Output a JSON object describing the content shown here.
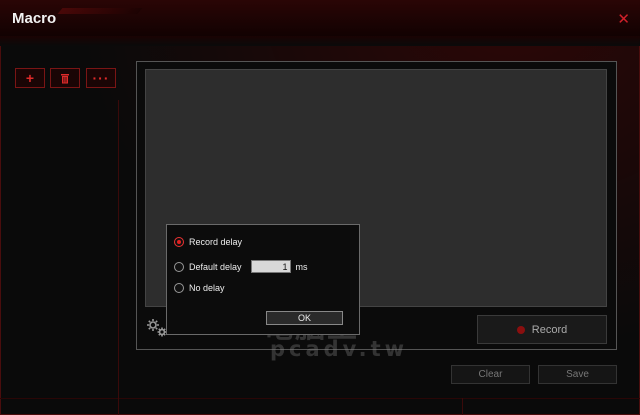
{
  "window": {
    "title": "Macro",
    "close_label": "✕"
  },
  "toolbar": {
    "add_label": "+",
    "delete_label": "🗑",
    "more_label": "···"
  },
  "popup": {
    "options": [
      {
        "label": "Record delay",
        "selected": true
      },
      {
        "label": "Default delay",
        "selected": false,
        "value": "1",
        "unit": "ms"
      },
      {
        "label": "No delay",
        "selected": false
      }
    ],
    "ok_label": "OK"
  },
  "actions": {
    "record_label": "Record",
    "clear_label": "Clear",
    "save_label": "Save"
  },
  "watermark": {
    "line1": "電腦王",
    "line2": "pcadv.tw"
  },
  "colors": {
    "accent": "#e02020",
    "background": "#0a0a0a",
    "panel": "#2d2d2d"
  }
}
